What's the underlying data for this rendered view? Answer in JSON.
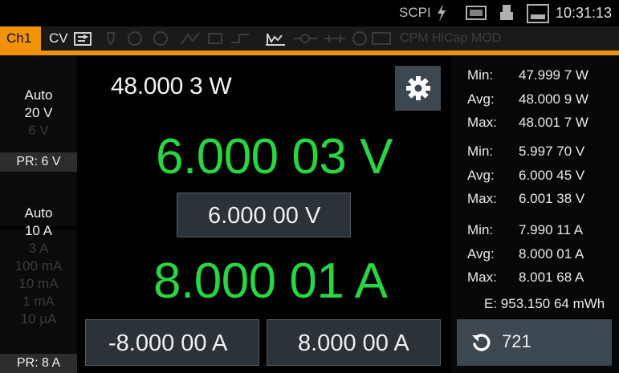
{
  "statusbar": {
    "scpi": "SCPI",
    "time": "10:31:13",
    "icons": [
      "lightning-icon",
      "usb-icon",
      "storage-icon",
      "display-icon"
    ]
  },
  "channel": {
    "tab": "Ch1",
    "mode": "CV",
    "extra_modes": "CPM HiCap MOD"
  },
  "left": {
    "voltage_ranges": {
      "top": "Auto",
      "selected": "20 V",
      "dim": "6 V",
      "pr": "PR: 6 V"
    },
    "current_ranges": {
      "top": "Auto",
      "selected": "10 A",
      "dim": [
        "3 A",
        "100 mA",
        "10 mA",
        "1 mA",
        "10 µA"
      ],
      "pr": "PR: 8 A"
    }
  },
  "main": {
    "power": "48.000 3 W",
    "voltage": "6.000 03 V",
    "voltage_set": "6.000 00  V",
    "current": "8.000 01 A",
    "limit_negative": "-8.000 00  A",
    "limit_positive": "8.000 00  A"
  },
  "stats": {
    "power": {
      "min_label": "Min:",
      "min": "47.999 7 W",
      "avg_label": "Avg:",
      "avg": "48.000 9 W",
      "max_label": "Max:",
      "max": "48.001 7 W"
    },
    "voltage": {
      "min_label": "Min:",
      "min": "5.997 70 V",
      "avg_label": "Avg:",
      "avg": "6.000 45 V",
      "max_label": "Max:",
      "max": "6.001 38 V"
    },
    "current": {
      "min_label": "Min:",
      "min": "7.990 11 A",
      "avg_label": "Avg:",
      "avg": "8.000 01 A",
      "max_label": "Max:",
      "max": "8.001 68 A"
    },
    "energy": "E:  953.150 64 mWh",
    "count": "721"
  },
  "colors": {
    "accent": "#f0920a",
    "measure_green": "#27d640",
    "button": "#3c4750"
  }
}
